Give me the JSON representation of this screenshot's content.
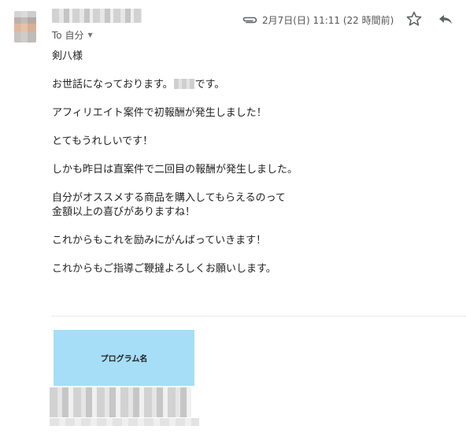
{
  "header": {
    "recipient_label": "To 自分",
    "date": "2月7日(日) 11:11 (22 時間前)"
  },
  "email": {
    "paragraphs": [
      "剣八様",
      "お世話になっております。",
      "アフィリエイト案件で初報酬が発生しました！",
      "とてもうれしいです！",
      "しかも昨日は直案件で二回目の報酬が発生しました。",
      "自分がオススメする商品を購入してもらえるのって",
      "金額以上の喜びがありますね！",
      "これからもこれを励みにがんばっていきます！",
      "これからもご指導ご鞭撻よろしくお願いします。"
    ],
    "greeting_suffix": "です。"
  },
  "banner": {
    "label": "プログラム名",
    "color": "#a5def6"
  },
  "icons": {
    "attachment": "paperclip-icon",
    "star": "star-icon",
    "reply": "reply-icon",
    "dropdown": "caret-down-icon"
  }
}
